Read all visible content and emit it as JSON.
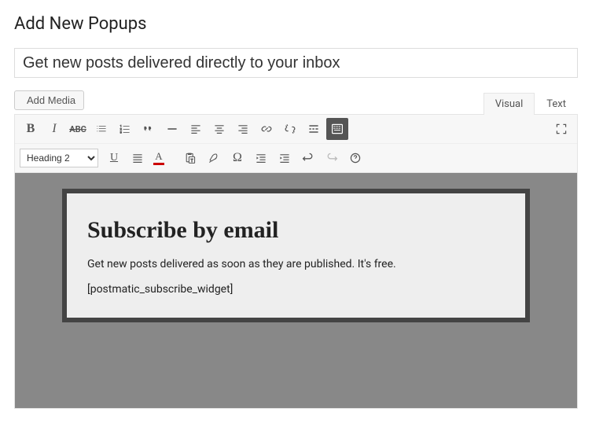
{
  "page_title": "Add New Popups",
  "title_field": {
    "value": "Get new posts delivered directly to your inbox"
  },
  "add_media_label": "Add Media",
  "tabs": {
    "visual": "Visual",
    "text": "Text"
  },
  "format_select": {
    "value": "Heading 2"
  },
  "toolbar_row1": {
    "bold": "B",
    "italic": "I",
    "text_color_letter": "A",
    "text_color_hex": "#c00"
  },
  "content": {
    "heading": "Subscribe by email",
    "paragraph": "Get new posts delivered as soon as they are published. It's free.",
    "shortcode": "[postmatic_subscribe_widget]"
  }
}
